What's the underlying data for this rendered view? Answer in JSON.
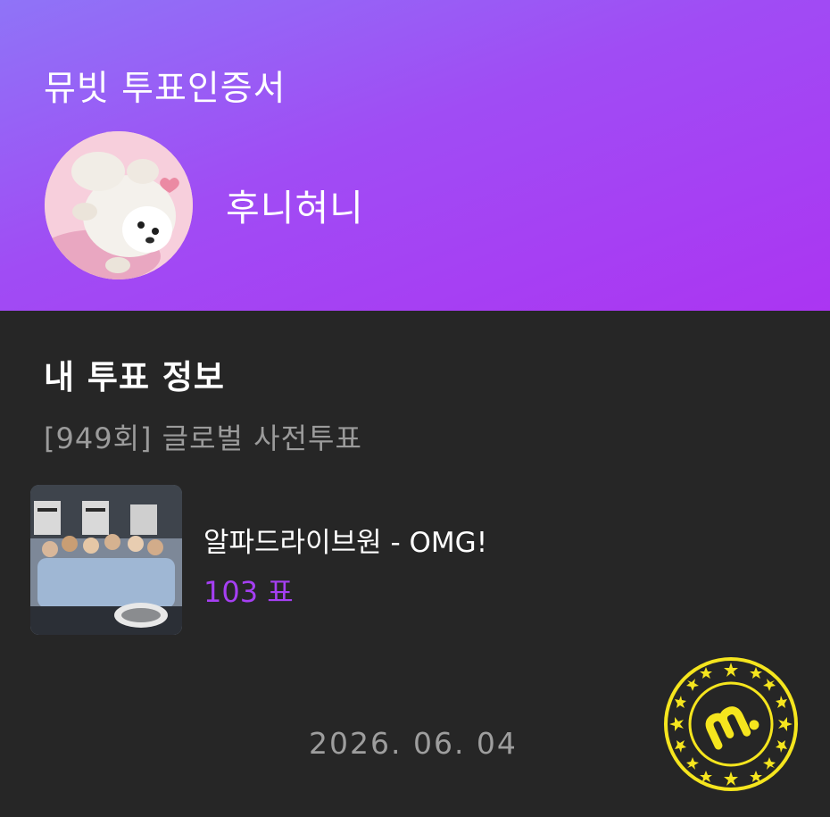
{
  "header": {
    "title": "뮤빗 투표인증서",
    "username": "후니혀니",
    "gradient_start": "#8f74f7",
    "gradient_end": "#ab35f2"
  },
  "vote_info": {
    "section_title": "내 투표 정보",
    "round": "[949회] 글로벌 사전투표",
    "song": "알파드라이브원 - OMG!",
    "votes": "103 표",
    "votes_color": "#a53ff2",
    "date": "2026. 06. 04"
  },
  "stamp": {
    "icon": "mubeat-logo-stamp",
    "color": "#f5e51e"
  }
}
